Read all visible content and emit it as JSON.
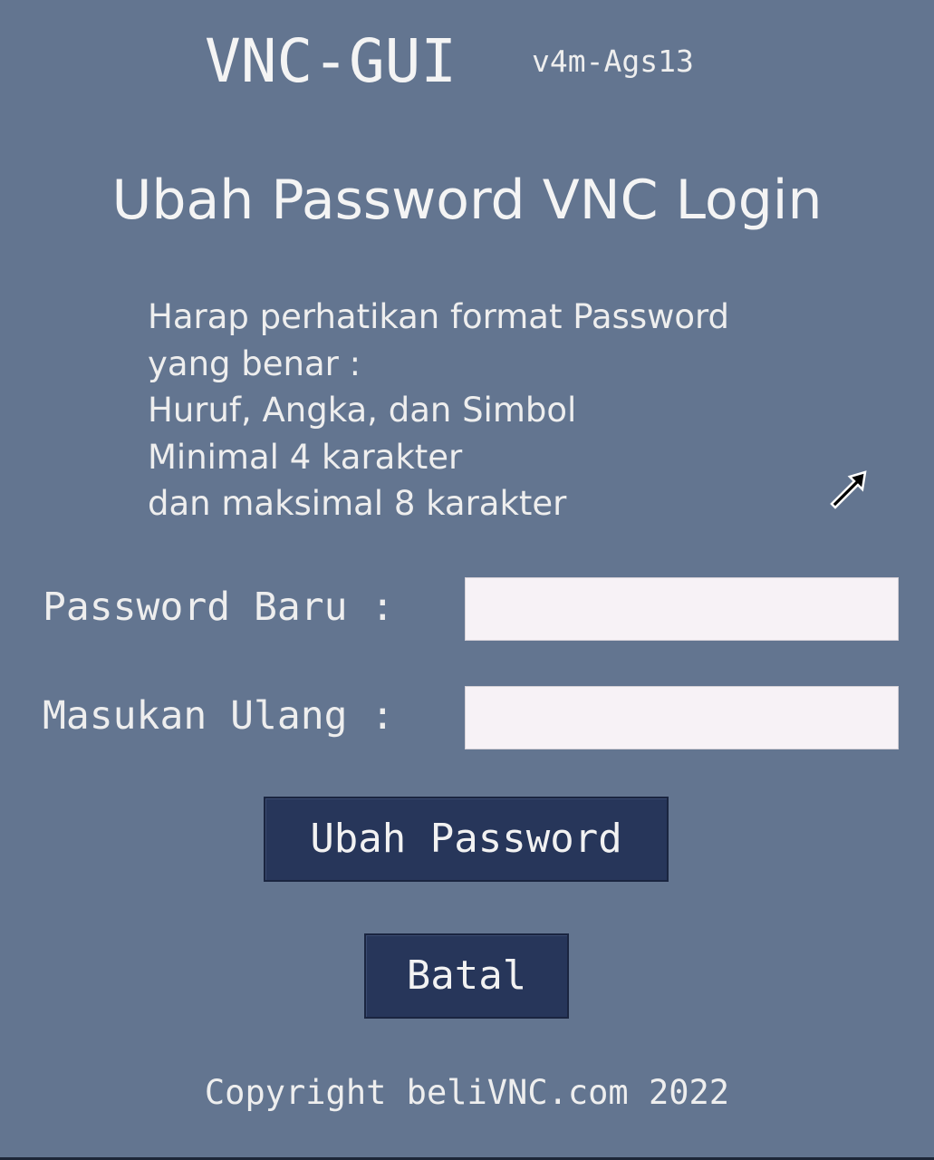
{
  "header": {
    "app_title": "VNC-GUI",
    "version": "v4m-Ags13"
  },
  "page": {
    "title": "Ubah Password VNC Login"
  },
  "instructions": {
    "lines": [
      "Harap perhatikan format Password",
      "yang benar :",
      "Huruf, Angka, dan Simbol",
      "Minimal 4 karakter",
      "dan maksimal 8 karakter"
    ]
  },
  "form": {
    "new_password_label": "Password Baru :",
    "new_password_value": "",
    "repeat_label": "Masukan Ulang :",
    "repeat_value": ""
  },
  "buttons": {
    "change_password": "Ubah Password",
    "cancel": "Batal"
  },
  "footer": {
    "copyright": "Copyright beliVNC.com 2022"
  },
  "colors": {
    "background": "#637590",
    "button": "#27365a",
    "input": "#f7f2f6",
    "text": "#f2f2f2"
  },
  "icons": {
    "cursor": "arrow-cursor-icon"
  }
}
